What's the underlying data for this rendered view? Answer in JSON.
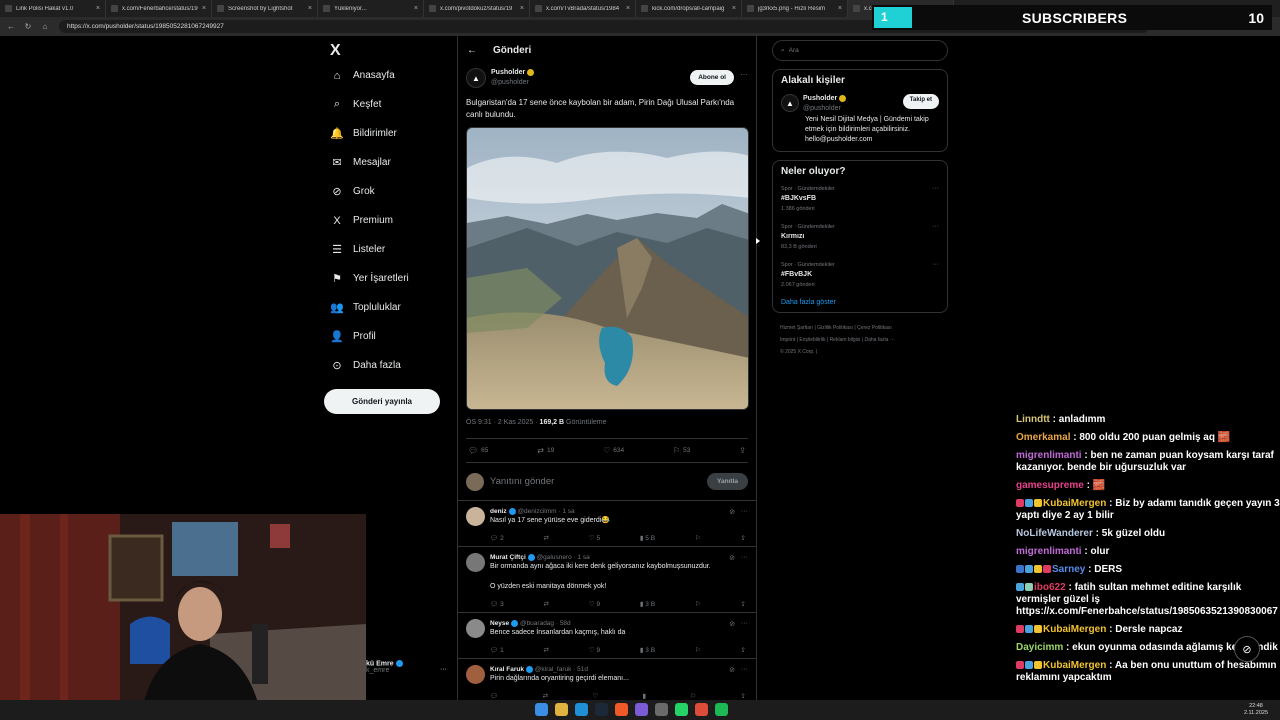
{
  "browser": {
    "tabs": [
      {
        "title": "Link Polisi Hakat v1.0"
      },
      {
        "title": "x.com/Fenerbahce/status/19"
      },
      {
        "title": "Screenshot by Lightshot"
      },
      {
        "title": "Yükleniyor..."
      },
      {
        "title": "x.com/pivotdokuz/status/19"
      },
      {
        "title": "x.com/TvBrada/status/1984"
      },
      {
        "title": "kick.com/drops/all-campaig"
      },
      {
        "title": "jg3rkx5.png - Hızlı Resim"
      },
      {
        "title": "x.com/pusholder/status"
      }
    ],
    "url": "https://x.com/pusholder/status/1985052281067249927"
  },
  "overlay": {
    "sub_progress": "1",
    "sub_label": "SUBSCRIBERS",
    "sub_goal": "10"
  },
  "nav": {
    "logo": "X",
    "items": [
      {
        "label": "Anasayfa",
        "icon": "home-icon",
        "glyph": "⌂"
      },
      {
        "label": "Keşfet",
        "icon": "search-icon",
        "glyph": "⌕"
      },
      {
        "label": "Bildirimler",
        "icon": "bell-icon",
        "glyph": "🔔"
      },
      {
        "label": "Mesajlar",
        "icon": "mail-icon",
        "glyph": "✉"
      },
      {
        "label": "Grok",
        "icon": "grok-icon",
        "glyph": "⊘"
      },
      {
        "label": "Premium",
        "icon": "x-logo-icon",
        "glyph": "X"
      },
      {
        "label": "Listeler",
        "icon": "list-icon",
        "glyph": "☰"
      },
      {
        "label": "Yer İşaretleri",
        "icon": "bookmark-icon",
        "glyph": "⚑"
      },
      {
        "label": "Topluluklar",
        "icon": "people-icon",
        "glyph": "👥"
      },
      {
        "label": "Profil",
        "icon": "person-icon",
        "glyph": "👤"
      },
      {
        "label": "Daha fazla",
        "icon": "more-circle-icon",
        "glyph": "⊙"
      }
    ],
    "post_button": "Gönderi yayınla",
    "account_name": "kü Emre",
    "account_handle": "k_emre"
  },
  "main": {
    "header": "Gönderi",
    "tweet": {
      "name": "Pusholder",
      "handle": "@pusholder",
      "follow": "Abone ol",
      "text": "Bulgaristan'da 17 sene önce kaybolan bir adam, Pirin Dağı Ulusal Parkı'nda canlı bulundu.",
      "time": "ÖS 9:31 · 2 Kas 2025 · ",
      "views_count": "169,2 B",
      "views_label": " Görüntüleme",
      "replies": "65",
      "retweets": "19",
      "likes": "634",
      "bookmarks": "53"
    },
    "reply_placeholder": "Yanıtını gönder",
    "reply_button": "Yanıtla",
    "comments": [
      {
        "name": "deniz",
        "handle": "@denizcilmm · 1 sa",
        "text": "Nasıl ya 17 sene yürüse eve giderdi😂",
        "replies": "2",
        "retweets": "",
        "likes": "5",
        "views": "5 B",
        "color": "#c9b39b"
      },
      {
        "name": "Murat Çiftçi",
        "handle": "@galusnero · 1 sa",
        "text": "Bir ormanda aynı ağaca iki kere denk geliyorsanız kaybolmuşsunuzdur.\n\nO yüzden eski manitaya dönmek yok!",
        "replies": "3",
        "retweets": "",
        "likes": "9",
        "views": "3 B",
        "color": "#777"
      },
      {
        "name": "Neyse",
        "handle": "@buaradag · 58d",
        "text": "Bence sadece İnsanlardan kaçmış, haklı da",
        "replies": "1",
        "retweets": "",
        "likes": "9",
        "views": "3 B",
        "color": "#8a8a8a"
      },
      {
        "name": "Kıral Faruk",
        "handle": "@kiral_faruk · 51d",
        "text": "Pirin dağlarında oryantiring geçirdi elemanı...",
        "replies": "",
        "retweets": "",
        "likes": "",
        "views": "",
        "color": "#a06040"
      }
    ]
  },
  "right": {
    "search_placeholder": "Ara",
    "related_title": "Alakalı kişiler",
    "related": {
      "name": "Pusholder",
      "handle": "@pusholder",
      "follow": "Takip et",
      "bio": "Yeni Nesil Dijital Medya | Gündemi takip etmek için bildirimleri açabilirsiniz. hello@pusholder.com"
    },
    "trends_title": "Neler oluyor?",
    "trends": [
      {
        "category": "Spor · Gündemdekiler",
        "name": "#BJKvsFB",
        "count": "1.386 gönderi"
      },
      {
        "category": "Spor · Gündemdekiler",
        "name": "Kırmızı",
        "count": "83,3 B gönderi"
      },
      {
        "category": "Spor · Gündemdekiler",
        "name": "#FBvBJK",
        "count": "2.067 gönderi"
      }
    ],
    "show_more": "Daha fazla göster",
    "footer": [
      "Hizmet Şartları",
      "Gizlilik Politikası",
      "Çerez Politikası",
      "Imprint",
      "Erişilebilirlik",
      "Reklam bilgisi",
      "Daha fazla ···",
      "© 2025 X Corp."
    ]
  },
  "chat": [
    {
      "user": "Linndtt",
      "color": "#d6c47a",
      "msg": "anladımm",
      "badges": []
    },
    {
      "user": "Omerkamal",
      "color": "#e9a64a",
      "msg": "800 oldu 200 puan gelmiş aq 🧱",
      "badges": []
    },
    {
      "user": "migrenlimanti",
      "color": "#c06ad6",
      "msg": "ben ne zaman puan koysam karşı taraf kazanıyor. bende bir uğursuzluk var",
      "badges": []
    },
    {
      "user": "gamesupreme",
      "color": "#e6428a",
      "msg": "🧱",
      "badges": []
    },
    {
      "user": "KubaiMergen",
      "color": "#f1c232",
      "msg": "Biz by adamı tanıdık geçen yayın 3 yaptı diye 2 ay 1 bilir",
      "badges": [
        "#e03c62",
        "#4aa3df",
        "#f1c232"
      ]
    },
    {
      "user": "NoLifeWanderer",
      "color": "#b8c7e0",
      "msg": "5k güzel oldu",
      "badges": []
    },
    {
      "user": "migrenlimanti",
      "color": "#c06ad6",
      "msg": "olur",
      "badges": []
    },
    {
      "user": "Sarney",
      "color": "#5a8be8",
      "msg": "DERS",
      "badges": [
        "#3a73c9",
        "#4aa3df",
        "#f1c232",
        "#e03c62"
      ]
    },
    {
      "user": "ibo622",
      "color": "#e03c62",
      "msg": "fatih sultan mehmet editine karşılık vermişler güzel iş https://x.com/Fenerbahce/status/1985063521390830067",
      "badges": [
        "#4aa3df",
        "#8ed0b5"
      ]
    },
    {
      "user": "KubaiMergen",
      "color": "#f1c232",
      "msg": "Dersle napcaz",
      "badges": [
        "#e03c62",
        "#4aa3df",
        "#f1c232"
      ]
    },
    {
      "user": "Dayicimm",
      "color": "#9ad66a",
      "msg": "ekun oyunma odasında ağlamış keyiflendik",
      "badges": []
    },
    {
      "user": "KubaiMergen",
      "color": "#f1c232",
      "msg": "Aa ben onu unuttum of hesabımın reklamını yapcaktım",
      "badges": [
        "#e03c62",
        "#4aa3df",
        "#f1c232"
      ]
    }
  ],
  "taskbar": {
    "icons": [
      "windows-icon",
      "explorer-icon",
      "edge-icon",
      "steam-icon",
      "app-icon",
      "app-icon",
      "app-icon",
      "whatsapp-icon",
      "chrome-icon",
      "spotify-icon"
    ],
    "colors": [
      "#3a8ee6",
      "#e0b341",
      "#1f8fd6",
      "#1b2838",
      "#f05a28",
      "#7b5cd6",
      "#6a6a6a",
      "#25d366",
      "#dd4b39",
      "#1db954"
    ],
    "time": "22:48",
    "date": "2.11.2025"
  }
}
